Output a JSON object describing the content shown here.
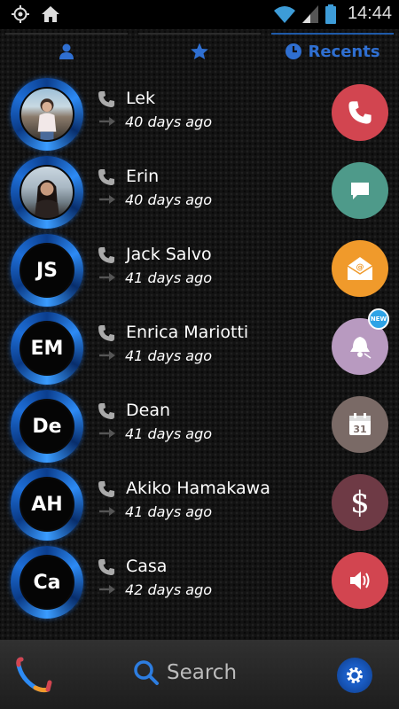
{
  "status_bar": {
    "time": "14:44",
    "left_icons": [
      "gps-icon",
      "home-icon"
    ],
    "right_icons": [
      "wifi-icon",
      "signal-icon",
      "battery-icon"
    ]
  },
  "tabs": [
    {
      "id": "contacts",
      "icon": "person-icon",
      "label": ""
    },
    {
      "id": "favorites",
      "icon": "star-icon",
      "label": ""
    },
    {
      "id": "recents",
      "icon": "clock-icon",
      "label": "Recents",
      "active": true
    }
  ],
  "contacts": [
    {
      "name": "Lek",
      "time": "40 days ago",
      "initials": "",
      "photo": true,
      "action": {
        "icon": "phone-icon",
        "color": "#d24550"
      }
    },
    {
      "name": "Erin",
      "time": "40 days ago",
      "initials": "",
      "photo": true,
      "action": {
        "icon": "message-icon",
        "color": "#4e9a8a"
      }
    },
    {
      "name": "Jack Salvo",
      "time": "41 days ago",
      "initials": "JS",
      "photo": false,
      "action": {
        "icon": "email-icon",
        "color": "#f09a2b"
      }
    },
    {
      "name": "Enrica Mariotti",
      "time": "41 days ago",
      "initials": "EM",
      "photo": false,
      "action": {
        "icon": "alarm-icon",
        "color": "#b89ac0",
        "badge": "NEW"
      }
    },
    {
      "name": "Dean",
      "time": "41 days ago",
      "initials": "De",
      "photo": false,
      "action": {
        "icon": "calendar-icon",
        "color": "#7a6a66",
        "value": "31"
      }
    },
    {
      "name": "Akiko Hamakawa",
      "time": "41 days ago",
      "initials": "AH",
      "photo": false,
      "action": {
        "icon": "dollar-icon",
        "color": "#6e3a45",
        "value": "$"
      }
    },
    {
      "name": "Casa",
      "time": "42 days ago",
      "initials": "Ca",
      "photo": false,
      "action": {
        "icon": "speaker-icon",
        "color": "#d24550"
      }
    }
  ],
  "bottom_bar": {
    "search_placeholder": "Search",
    "left_icon": "dialer-logo-icon",
    "right_icon": "settings-gear-icon"
  },
  "colors": {
    "accent": "#2f6fd1",
    "background": "#131313"
  }
}
